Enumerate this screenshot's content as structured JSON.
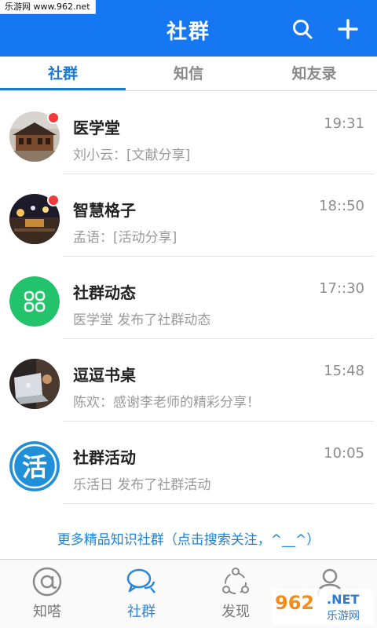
{
  "watermark": {
    "site": "乐游网 www.962.net",
    "logo": "962",
    "net": ".NET",
    "sub": "乐游网"
  },
  "header": {
    "title": "社群",
    "search_icon": "search-icon",
    "add_icon": "plus-icon"
  },
  "tabs": [
    {
      "label": "社群",
      "active": true
    },
    {
      "label": "知信",
      "active": false
    },
    {
      "label": "知友录",
      "active": false
    }
  ],
  "conversations": [
    {
      "name": "医学堂",
      "time": "19:31",
      "message": "刘小云：[文献分享]",
      "unread": true,
      "avatar": "photo-building"
    },
    {
      "name": "智慧格子",
      "time": "18::50",
      "message": "孟语：[活动分享]",
      "unread": true,
      "avatar": "photo-night-street"
    },
    {
      "name": "社群动态",
      "time": "17::30",
      "message": "医学堂 发布了社群动态",
      "unread": false,
      "avatar": "green-apps-icon"
    },
    {
      "name": "逗逗书桌",
      "time": "15:48",
      "message": "陈欢：感谢李老师的精彩分享！",
      "unread": false,
      "avatar": "photo-laptop"
    },
    {
      "name": "社群活动",
      "time": "10:05",
      "message": "乐活日 发布了社群活动",
      "unread": false,
      "avatar": "blue-huo-icon"
    }
  ],
  "more_link": "更多精品知识社群（点击搜索关注，^__^）",
  "activity_avatar_char": "活",
  "bottom_nav": [
    {
      "label": "知嗒",
      "icon": "at-icon",
      "active": false
    },
    {
      "label": "社群",
      "icon": "chat-bubbles-icon",
      "active": true
    },
    {
      "label": "发现",
      "icon": "discover-icon",
      "active": false
    },
    {
      "label": "",
      "icon": "person-icon",
      "active": false
    }
  ],
  "colors": {
    "primary": "#1677f2",
    "accent": "#1a7ad6",
    "unread": "#f23a3a",
    "green": "#22c36b"
  }
}
